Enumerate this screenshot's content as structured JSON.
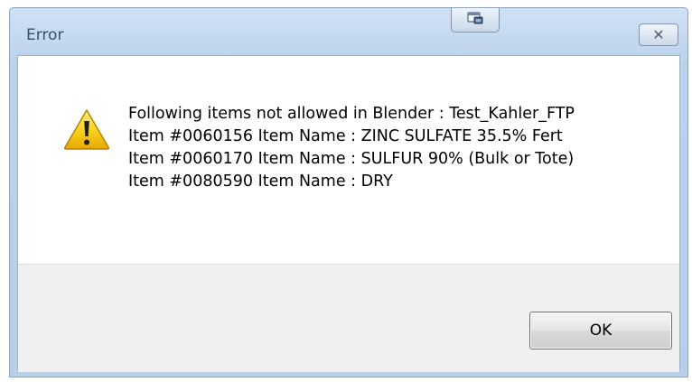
{
  "window": {
    "title": "Error"
  },
  "icons": {
    "warning": "warning-icon",
    "snap": "window-snap-icon",
    "close": "close-icon"
  },
  "message": {
    "lines": [
      "Following items not allowed in Blender : Test_Kahler_FTP",
      "Item #0060156 Item Name : ZINC SULFATE 35.5% Fert",
      "Item #0060170 Item Name : SULFUR 90% (Bulk or Tote)",
      "Item #0080590 Item Name : DRY"
    ]
  },
  "buttons": {
    "ok_label": "OK",
    "close_glyph": "✕"
  },
  "colors": {
    "frame": "#bcd2ec",
    "warning_yellow": "#f5c400",
    "footer": "#f0f0f0"
  }
}
